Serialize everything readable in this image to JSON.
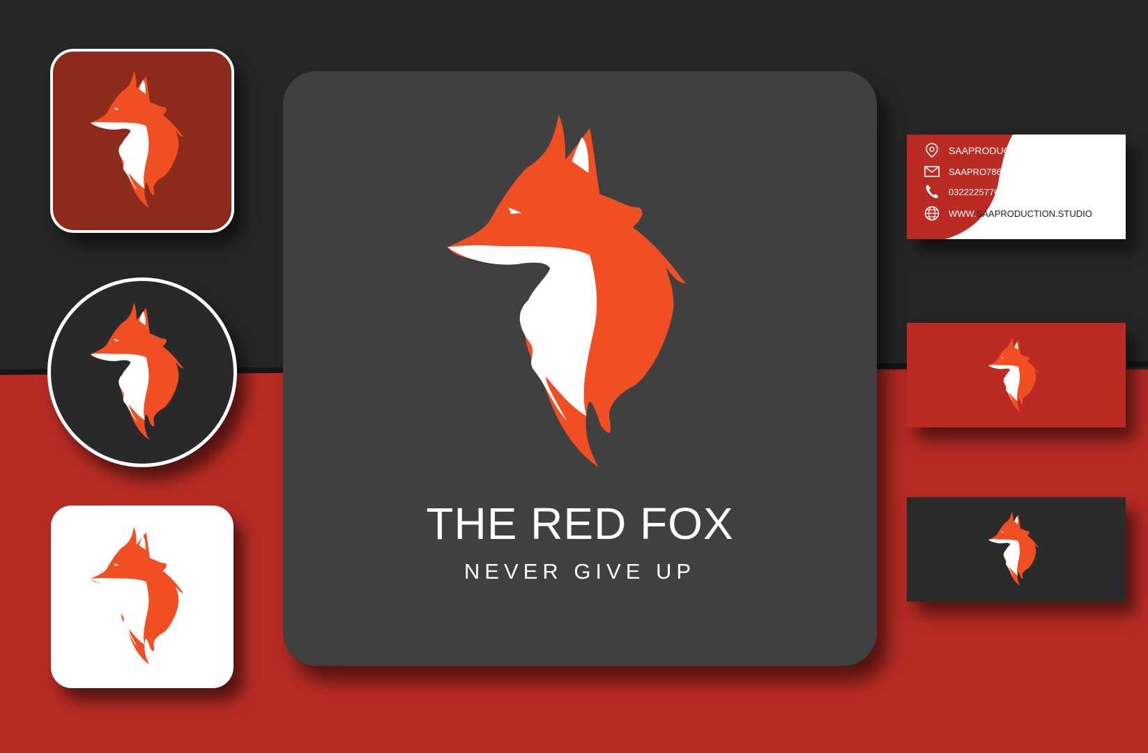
{
  "brand": {
    "name": "THE RED FOX",
    "slogan": "NEVER GIVE UP"
  },
  "contact_card": {
    "address_label": "SAAPRODUCTION IN PAKISTAN",
    "email_label": "SAAPRO786@GMAIL.COM",
    "phone_label": "03222257765",
    "website_prefix": "WWW.",
    "website_domain": "SAAPRODUCTION.STUDIO"
  },
  "colors": {
    "fox_orange": "#f04e23",
    "background_dark": "#262626",
    "background_red": "#b72b24",
    "card_dark": "#404040"
  },
  "icons": [
    "fox-logo-icon",
    "location-pin-icon",
    "mail-icon",
    "phone-icon",
    "globe-icon"
  ]
}
